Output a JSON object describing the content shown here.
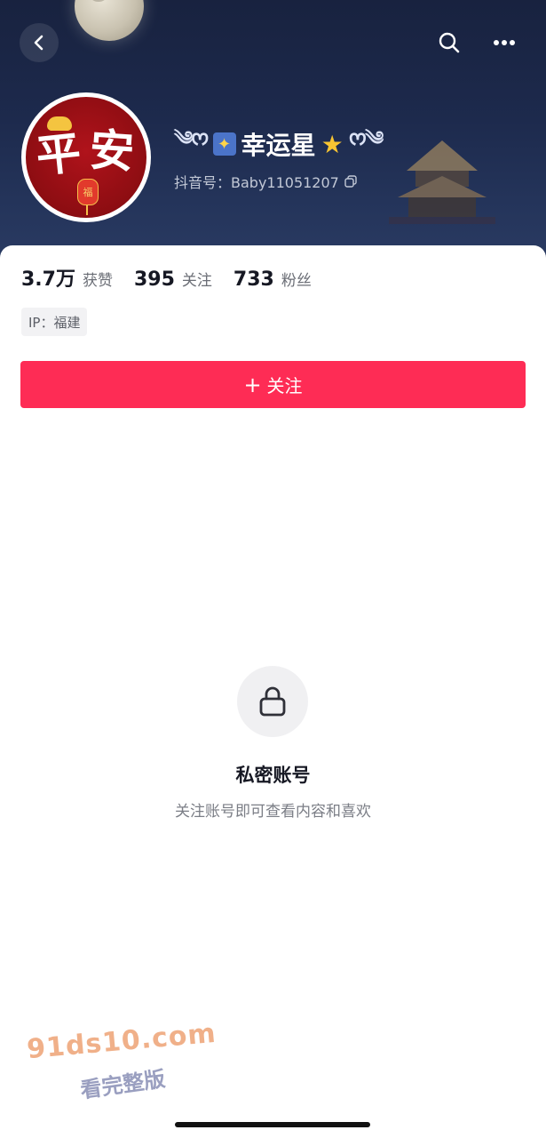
{
  "header": {
    "nickname": "幸运星",
    "cloud_left": "༄ᰔ",
    "cloud_right": "ᰔ༄",
    "douyin_id": "抖音号：Baby11051207",
    "avatar_chars": [
      "平",
      "安"
    ],
    "lantern_char": "福"
  },
  "stats": [
    {
      "num": "3.7万",
      "label": "获赞"
    },
    {
      "num": "395",
      "label": "关注"
    },
    {
      "num": "733",
      "label": "粉丝"
    }
  ],
  "ip_label": "IP：福建",
  "follow_button": {
    "plus": "+",
    "label": "关注"
  },
  "private": {
    "title": "私密账号",
    "subtitle": "关注账号即可查看内容和喜欢"
  },
  "watermark": {
    "url": "91ds10.com",
    "text": "看完整版"
  },
  "colors": {
    "accent": "#fe2c55",
    "banner": "#1d2a4d"
  },
  "icons": [
    "back-icon",
    "search-icon",
    "more-icon",
    "copy-icon",
    "lock-icon"
  ]
}
